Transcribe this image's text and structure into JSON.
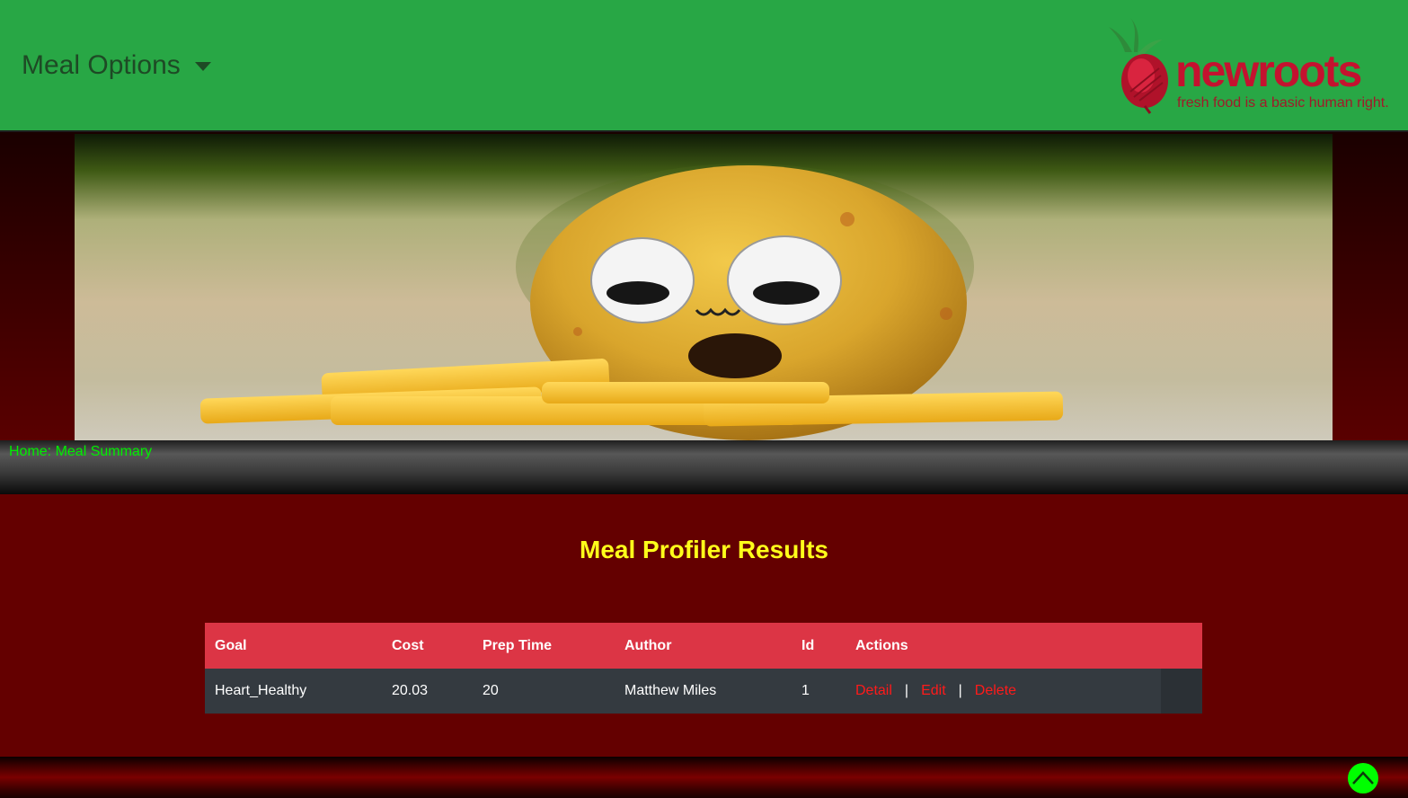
{
  "navbar": {
    "menu_label": "Meal Options",
    "background": "#28a745"
  },
  "logo": {
    "word_new": "new",
    "word_roots": "roots",
    "tagline": "fresh food is a basic human right."
  },
  "hero": {
    "image": "potato-with-googly-eyes-and-fries"
  },
  "breadcrumb": {
    "text": "Home: Meal Summary"
  },
  "main": {
    "title": "Meal Profiler Results",
    "table": {
      "headers": [
        "Goal",
        "Cost",
        "Prep Time",
        "Author",
        "Id",
        "Actions"
      ],
      "rows": [
        {
          "goal": "Heart_Healthy",
          "cost": "20.03",
          "prep_time": "20",
          "author": "Matthew Miles",
          "id": "1",
          "actions": {
            "detail": "Detail",
            "edit": "Edit",
            "delete": "Delete",
            "separator": "|"
          }
        }
      ]
    }
  },
  "scroll_top": {
    "icon": "chevron-up-icon"
  },
  "colors": {
    "header_row": "#dc3545",
    "body_row": "#343a40",
    "title": "#ffff1a",
    "breadcrumb": "#00ee00",
    "action_link": "#ff1a1a",
    "page_bg": "#640000"
  }
}
